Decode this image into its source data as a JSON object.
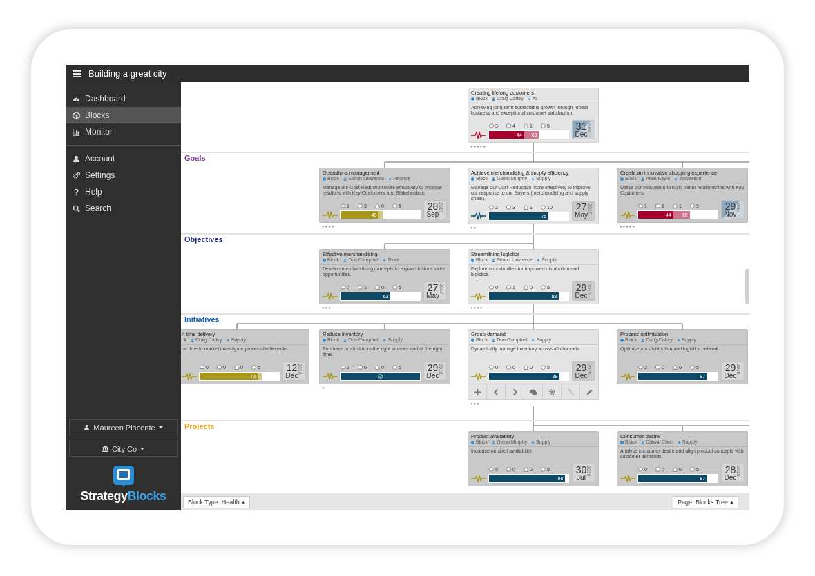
{
  "window": {
    "title": "Building a great city"
  },
  "sidebar": {
    "items": [
      {
        "label": "Dashboard",
        "selected": false
      },
      {
        "label": "Blocks",
        "selected": true
      },
      {
        "label": "Monitor",
        "selected": false
      },
      {
        "label": "Account",
        "selected": false
      },
      {
        "label": "Settings",
        "selected": false
      },
      {
        "label": "Help",
        "selected": false
      },
      {
        "label": "Search",
        "selected": false
      }
    ],
    "user_button": "Maureen Placente",
    "org_button": "City Co",
    "logo": {
      "first": "Strategy",
      "second": "Blocks"
    }
  },
  "bands": [
    {
      "cards": [
        {
          "title": "Creating lifelong customers",
          "meta": [
            {
              "kind": "block",
              "text": "Block"
            },
            {
              "kind": "owner",
              "text": "Craig Catley"
            },
            {
              "kind": "tag",
              "text": "All"
            }
          ],
          "description": "Achieving long term sustainable growth through repeat business and exceptional customer satisfaction.",
          "counters": [
            "3",
            "4",
            "1",
            "5"
          ],
          "pulse": {
            "color": "#b0102a"
          },
          "bar": {
            "level": 0.44,
            "value": "44",
            "color": "#a5002b",
            "target": {
              "level": 0.63,
              "value": "63"
            }
          },
          "date": {
            "day": "31",
            "month": "Dec",
            "year": "2018",
            "overdue": true
          },
          "highlighted": true,
          "dots": "●●●●●"
        }
      ]
    },
    {
      "label": "Goals",
      "color": "#7b3f8c",
      "cards": [
        {
          "title": "Operations management",
          "meta": [
            {
              "kind": "block",
              "text": "Block"
            },
            {
              "kind": "owner",
              "text": "Simon Lawrence"
            },
            {
              "kind": "tag",
              "text": "Finance"
            }
          ],
          "description": "Manage our Cost Reduction more effectively to improve relations with Key Customers and Stakeholders.",
          "counters": [
            "1",
            "3",
            "0",
            "5"
          ],
          "pulse": {
            "color": "#a8961a"
          },
          "bar": {
            "level": 0.48,
            "value": "48",
            "color": "#a8961a",
            "target": {
              "level": 0.53
            }
          },
          "date": {
            "day": "28",
            "month": "Sep",
            "year": "2017",
            "overdue": false
          },
          "highlighted": false,
          "dots": "●●●●"
        },
        {
          "title": "Achieve merchandising & supply efficiency",
          "meta": [
            {
              "kind": "block",
              "text": "Block"
            },
            {
              "kind": "owner",
              "text": "Glenn Murphy"
            },
            {
              "kind": "tag",
              "text": "Supply"
            }
          ],
          "description": "Manage our Cost Reduction more effectively to improve our response to our Buyers (merchandising and supply chain).",
          "counters": [
            "2",
            "3",
            "1",
            "10"
          ],
          "pulse": {
            "color": "#0e4a66"
          },
          "bar": {
            "level": 0.75,
            "value": "75",
            "color": "#0e4a66"
          },
          "date": {
            "day": "27",
            "month": "May",
            "year": "2017",
            "overdue": false
          },
          "highlighted": true,
          "dots": "●●"
        },
        {
          "title": "Create an innovative shopping experience",
          "meta": [
            {
              "kind": "block",
              "text": "Block"
            },
            {
              "kind": "owner",
              "text": "Allen Keyle"
            },
            {
              "kind": "tag",
              "text": "Innovation"
            }
          ],
          "description": "Utilise our Innovation to build better relationships with Key Customers.",
          "counters": [
            "1",
            "1",
            "1",
            "9"
          ],
          "pulse": {
            "color": "#a8961a"
          },
          "bar": {
            "level": 0.44,
            "value": "44",
            "color": "#a5002b",
            "target": {
              "level": 0.65,
              "value": "65"
            }
          },
          "date": {
            "day": "29",
            "month": "Nov",
            "year": "2017",
            "overdue": true
          },
          "highlighted": false,
          "dots": "●●●●●"
        }
      ]
    },
    {
      "label": "Objectives",
      "color": "#1e2a78",
      "cards": [
        {
          "title": "Effective merchandising",
          "meta": [
            {
              "kind": "block",
              "text": "Block"
            },
            {
              "kind": "owner",
              "text": "Don Campbell"
            },
            {
              "kind": "tag",
              "text": "Store"
            }
          ],
          "description": "Develop merchandising concepts to expand instore sales opportunities.",
          "counters": [
            "0",
            "1",
            "0",
            "5"
          ],
          "pulse": {
            "color": "#a8961a"
          },
          "bar": {
            "level": 0.63,
            "value": "63",
            "color": "#0e4a66"
          },
          "date": {
            "day": "27",
            "month": "May",
            "year": "2017",
            "overdue": false
          },
          "highlighted": false,
          "dots": "●●●"
        },
        {
          "title": "Streamlining logistics",
          "meta": [
            {
              "kind": "block",
              "text": "Block"
            },
            {
              "kind": "owner",
              "text": "Simon Lawrence"
            },
            {
              "kind": "tag",
              "text": "Supply"
            }
          ],
          "description": "Explore opportunities for improved distribution and logistics.",
          "counters": [
            "0",
            "1",
            "0",
            "5"
          ],
          "pulse": {
            "color": "#a8961a"
          },
          "bar": {
            "level": 0.88,
            "value": "88",
            "color": "#0e4a66"
          },
          "date": {
            "day": "29",
            "month": "Dec",
            "year": "2016",
            "overdue": false
          },
          "highlighted": true,
          "dots": "●●●●"
        }
      ]
    },
    {
      "label": "Initiatives",
      "color": "#1565c0",
      "cards": [
        {
          "title": "n time delivery",
          "meta": [
            {
              "kind": "cut",
              "text": "ck"
            },
            {
              "kind": "owner",
              "text": "Craig Catley"
            },
            {
              "kind": "tag",
              "text": "Supply"
            }
          ],
          "description": "ue time to market investigate process bottlenecks.",
          "counters": [
            "0",
            "0",
            "0",
            "5"
          ],
          "pulse": {
            "color": "#a8961a"
          },
          "bar": {
            "level": 0.73,
            "value": "73",
            "color": "#a8961a",
            "target": {
              "level": 0.78
            }
          },
          "date": {
            "day": "12",
            "month": "Dec",
            "year": "2016",
            "overdue": false
          },
          "highlighted": false
        },
        {
          "title": "Reduce inventory",
          "meta": [
            {
              "kind": "block",
              "text": "Block"
            },
            {
              "kind": "owner",
              "text": "Don Campbell"
            },
            {
              "kind": "tag",
              "text": "Supply"
            }
          ],
          "description": "Purchase product from the right sources and at the right time.",
          "counters": [
            "2",
            "0",
            "0",
            "5"
          ],
          "pulse": {
            "color": "#a8961a"
          },
          "bar": {
            "level": 1,
            "complete": true,
            "color": "#0e4a66"
          },
          "date": {
            "day": "29",
            "month": "Dec",
            "year": "2016",
            "overdue": false
          },
          "highlighted": false,
          "dots": "●"
        },
        {
          "title": "Group demand",
          "meta": [
            {
              "kind": "block",
              "text": "Block"
            },
            {
              "kind": "owner",
              "text": "Don Campbell"
            },
            {
              "kind": "tag",
              "text": "Supply"
            }
          ],
          "description": "Dynamically manage inventory across all channels.",
          "counters": [
            "0",
            "0",
            "0",
            "5"
          ],
          "pulse": {
            "color": "#a8961a"
          },
          "bar": {
            "level": 0.89,
            "value": "89",
            "color": "#0e4a66"
          },
          "date": {
            "day": "29",
            "month": "Dec",
            "year": "2016",
            "overdue": false
          },
          "highlighted": true,
          "dots": "●●●",
          "toolbar": [
            {
              "kind": "add",
              "disabled": false
            },
            {
              "kind": "previous",
              "disabled": false
            },
            {
              "kind": "next",
              "disabled": false
            },
            {
              "kind": "comments",
              "disabled": false
            },
            {
              "kind": "settings",
              "disabled": false
            },
            {
              "kind": "gavel",
              "disabled": true
            },
            {
              "kind": "edit",
              "disabled": false
            }
          ]
        },
        {
          "title": "Process optimisation",
          "meta": [
            {
              "kind": "block",
              "text": "Block"
            },
            {
              "kind": "owner",
              "text": "Craig Catley"
            },
            {
              "kind": "tag",
              "text": "Supply"
            }
          ],
          "description": "Optimise our distribution and logistics network.",
          "counters": [
            "2",
            "0",
            "0",
            "5"
          ],
          "pulse": {
            "color": "#a8961a"
          },
          "bar": {
            "level": 0.87,
            "value": "87",
            "color": "#0e4a66"
          },
          "date": {
            "day": "29",
            "month": "Dec",
            "year": "2016",
            "overdue": false
          },
          "highlighted": false
        }
      ]
    },
    {
      "label": "Projects",
      "color": "#f0a020",
      "cards": [
        {
          "title": "Product availability",
          "meta": [
            {
              "kind": "block",
              "text": "Block"
            },
            {
              "kind": "owner",
              "text": "Glenn Murphy"
            },
            {
              "kind": "tag",
              "text": "Supply"
            }
          ],
          "description": "Increase on shelf availability.",
          "counters": [
            "5",
            "0",
            "0",
            "5"
          ],
          "pulse": {
            "color": "#a8961a"
          },
          "bar": {
            "level": 0.96,
            "value": "96",
            "color": "#0e4a66"
          },
          "date": {
            "day": "30",
            "month": "Jul",
            "year": "2016",
            "overdue": false
          },
          "highlighted": false
        },
        {
          "title": "Consumer desire",
          "meta": [
            {
              "kind": "block",
              "text": "Block"
            },
            {
              "kind": "owner",
              "text": "Chiwai Chun"
            },
            {
              "kind": "tag",
              "text": "Supply"
            }
          ],
          "description": "Analyse consumer desire and align product concepts with customer demands.",
          "counters": [
            "0",
            "0",
            "0",
            "5"
          ],
          "pulse": {
            "color": "#a8961a"
          },
          "bar": {
            "level": 0.87,
            "value": "87",
            "color": "#0e4a66"
          },
          "date": {
            "day": "28",
            "month": "Dec",
            "year": "2016",
            "overdue": false
          },
          "highlighted": false
        }
      ]
    }
  ],
  "bottom_bar": {
    "left_button": "Block Type: Health",
    "right_button": "Page: Blocks Tree"
  }
}
